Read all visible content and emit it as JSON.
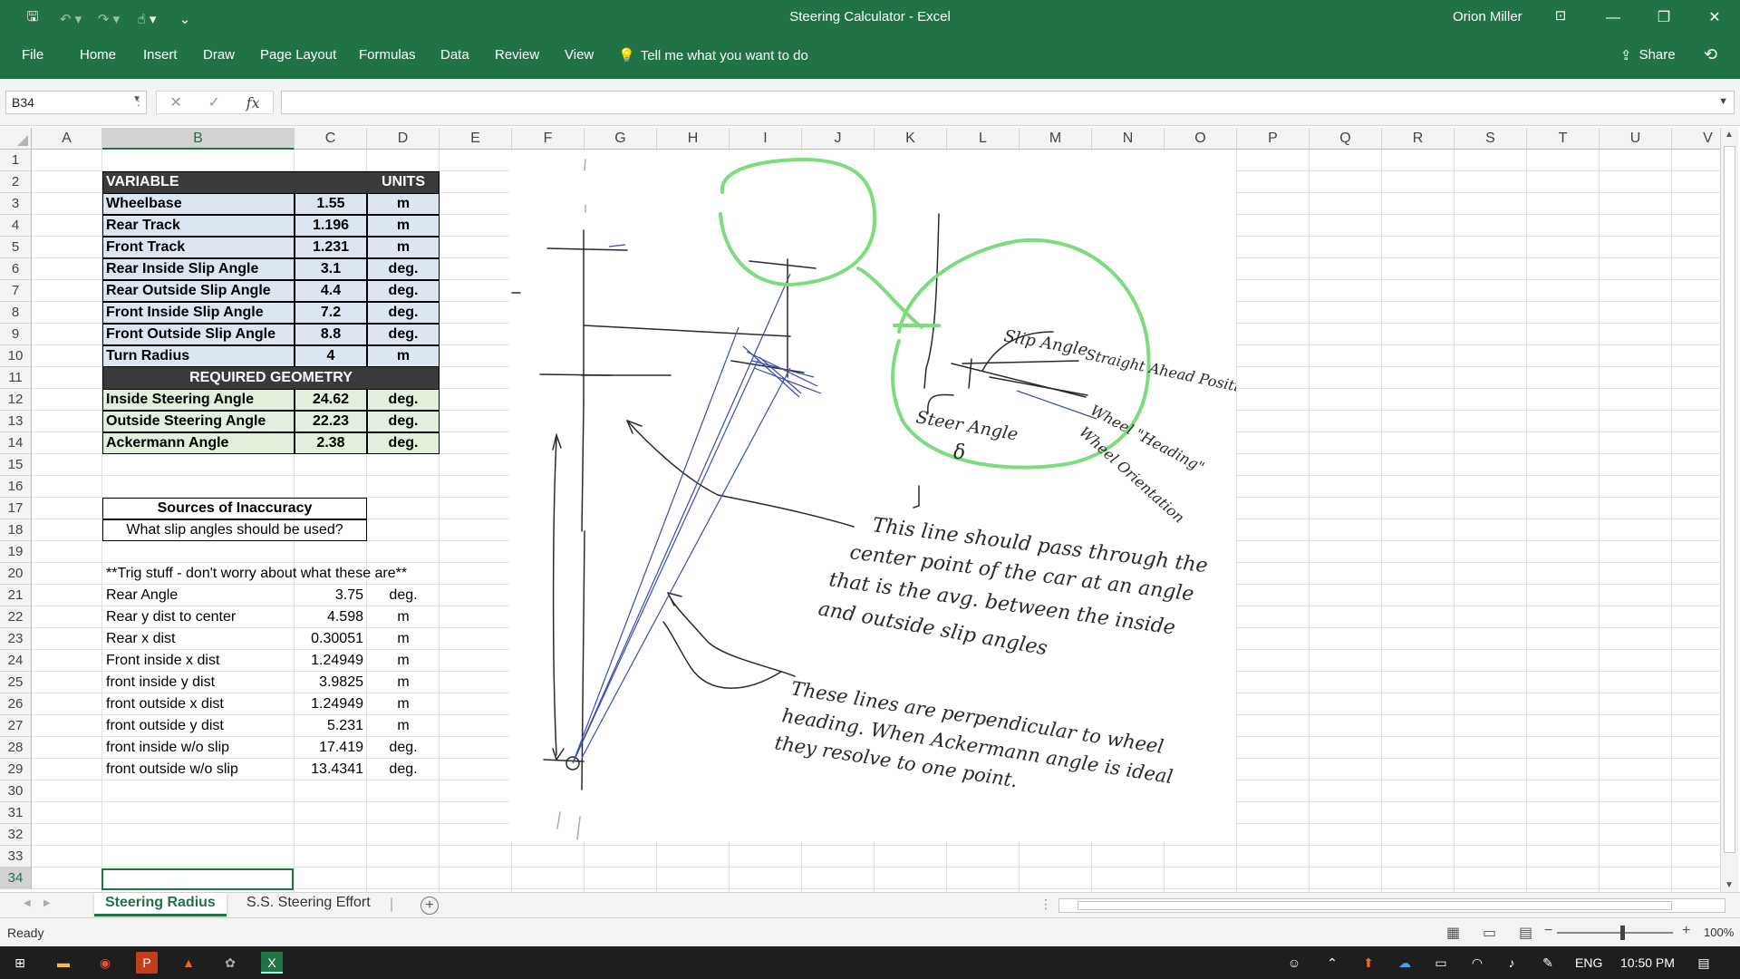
{
  "window": {
    "title": "Steering Calculator  -  Excel",
    "user": "Orion Miller"
  },
  "ribbon": {
    "tabs": [
      "File",
      "Home",
      "Insert",
      "Draw",
      "Page Layout",
      "Formulas",
      "Data",
      "Review",
      "View"
    ],
    "tell_me": "Tell me what you want to do",
    "share": "Share"
  },
  "formula_bar": {
    "name_box": "B34",
    "fx": "fx",
    "formula": ""
  },
  "columns": [
    "A",
    "B",
    "C",
    "D",
    "E",
    "F",
    "G",
    "H",
    "I",
    "J",
    "K",
    "L",
    "M",
    "N",
    "O",
    "P",
    "Q",
    "R",
    "S",
    "T",
    "U",
    "V"
  ],
  "rows": [
    "1",
    "2",
    "3",
    "4",
    "5",
    "6",
    "7",
    "8",
    "9",
    "10",
    "11",
    "12",
    "13",
    "14",
    "15",
    "16",
    "17",
    "18",
    "19",
    "20",
    "21",
    "22",
    "23",
    "24",
    "25",
    "26",
    "27",
    "28",
    "29",
    "30",
    "31",
    "32",
    "33",
    "34"
  ],
  "selected": {
    "column": "B",
    "row": "34"
  },
  "table": {
    "header_variable": "VARIABLE",
    "header_units": "UNITS",
    "inputs": [
      {
        "name": "Wheelbase",
        "value": "1.55",
        "unit": "m"
      },
      {
        "name": "Rear Track",
        "value": "1.196",
        "unit": "m"
      },
      {
        "name": "Front Track",
        "value": "1.231",
        "unit": "m"
      },
      {
        "name": "Rear Inside Slip Angle",
        "value": "3.1",
        "unit": "deg."
      },
      {
        "name": "Rear Outside Slip Angle",
        "value": "4.4",
        "unit": "deg."
      },
      {
        "name": "Front Inside Slip Angle",
        "value": "7.2",
        "unit": "deg."
      },
      {
        "name": "Front Outside Slip Angle",
        "value": "8.8",
        "unit": "deg."
      },
      {
        "name": "Turn Radius",
        "value": "4",
        "unit": "m"
      }
    ],
    "required_header": "REQUIRED GEOMETRY",
    "outputs": [
      {
        "name": "Inside Steering Angle",
        "value": "24.62",
        "unit": "deg."
      },
      {
        "name": "Outside Steering Angle",
        "value": "22.23",
        "unit": "deg."
      },
      {
        "name": "Ackermann Angle",
        "value": "2.38",
        "unit": "deg."
      }
    ]
  },
  "inaccuracy": {
    "title": "Sources of Inaccuracy",
    "item": "What slip angles should be used?"
  },
  "trig": {
    "note": "**Trig stuff - don't worry about what these are**",
    "rows": [
      {
        "name": "Rear Angle",
        "value": "3.75",
        "unit": "deg."
      },
      {
        "name": "Rear y dist to center",
        "value": "4.598",
        "unit": "m"
      },
      {
        "name": "Rear x dist",
        "value": "0.30051",
        "unit": "m"
      },
      {
        "name": "Front inside x dist",
        "value": "1.24949",
        "unit": "m"
      },
      {
        "name": "front inside y dist",
        "value": "3.9825",
        "unit": "m"
      },
      {
        "name": "front outside x dist",
        "value": "1.24949",
        "unit": "m"
      },
      {
        "name": "front outside y dist",
        "value": "5.231",
        "unit": "m"
      },
      {
        "name": "front inside w/o slip",
        "value": "17.419",
        "unit": "deg."
      },
      {
        "name": "front outside w/o slip",
        "value": "13.4341",
        "unit": "deg."
      }
    ]
  },
  "sketch": {
    "annotations": {
      "slip_angle": "Slip Angle",
      "straight_ahead": "Straight Ahead Position",
      "steer_angle": "Steer Angle",
      "delta": "δ",
      "wheel_heading": "Wheel \"Heading\"",
      "wheel_orientation": "Wheel Orientation",
      "note1_l1": "This line should pass through the",
      "note1_l2": "center point of the car at an angle",
      "note1_l3": "that is the avg. between the inside",
      "note1_l4": "and outside slip angles",
      "note2_l1": "These lines are perpendicular to wheel",
      "note2_l2": "heading. When Ackermann angle is ideal",
      "note2_l3": "they resolve to one point."
    },
    "colors": {
      "ink": "#2a2a2a",
      "highlight": "#7ddc7d",
      "pen_blue": "#3a4bb0"
    }
  },
  "sheets": [
    {
      "name": "Steering Radius",
      "active": true
    },
    {
      "name": "S.S. Steering Effort",
      "active": false
    }
  ],
  "status": {
    "ready": "Ready",
    "zoom": "100%"
  },
  "taskbar": {
    "language": "ENG",
    "time": "10:50 PM"
  },
  "colors": {
    "excel_green": "#217346",
    "blue_fill": "#dce6f1",
    "green_fill": "#e2efda",
    "dark_fill": "#3a3a3a"
  }
}
